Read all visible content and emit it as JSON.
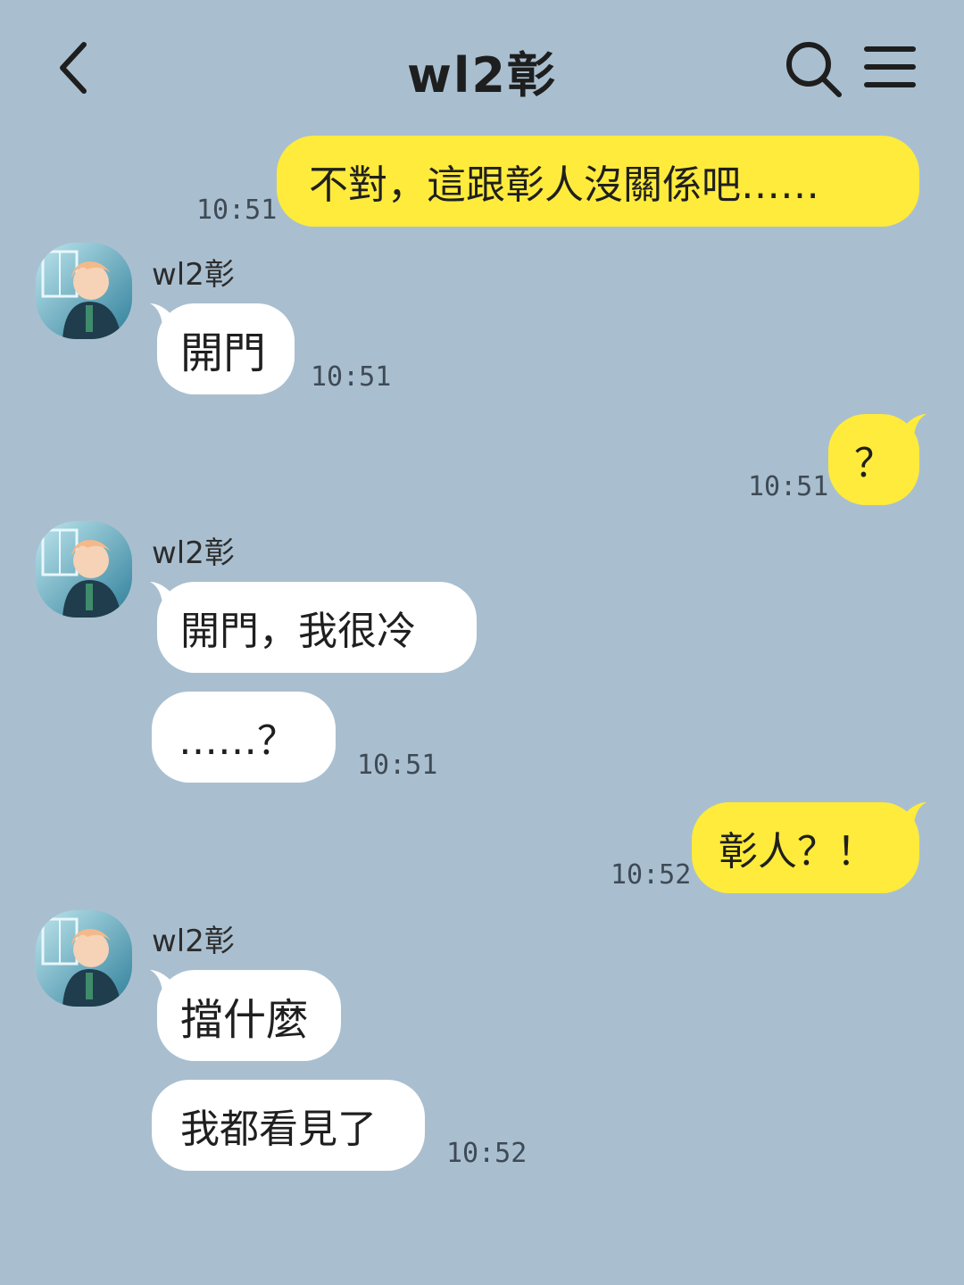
{
  "header": {
    "title": "wl2彰",
    "back_icon": "chevron-left-icon",
    "search_icon": "search-icon",
    "menu_icon": "hamburger-menu-icon"
  },
  "colors": {
    "background": "#a9bfd0",
    "incoming_bubble": "#ffffff",
    "outgoing_bubble": "#ffeb3b"
  },
  "messages": [
    {
      "direction": "outgoing",
      "text": "不對，這跟彰人沒關係吧……",
      "time": "10:51"
    },
    {
      "direction": "incoming",
      "sender": "wl2彰",
      "text": "開門",
      "time": "10:51"
    },
    {
      "direction": "outgoing",
      "text": "？",
      "time": "10:51"
    },
    {
      "direction": "incoming",
      "sender": "wl2彰",
      "text": "開門，我很冷"
    },
    {
      "direction": "incoming",
      "text": "……？",
      "time": "10:51"
    },
    {
      "direction": "outgoing",
      "text": "彰人？！",
      "time": "10:52"
    },
    {
      "direction": "incoming",
      "sender": "wl2彰",
      "text": "擋什麼"
    },
    {
      "direction": "incoming",
      "text": "我都看見了",
      "time": "10:52"
    }
  ]
}
